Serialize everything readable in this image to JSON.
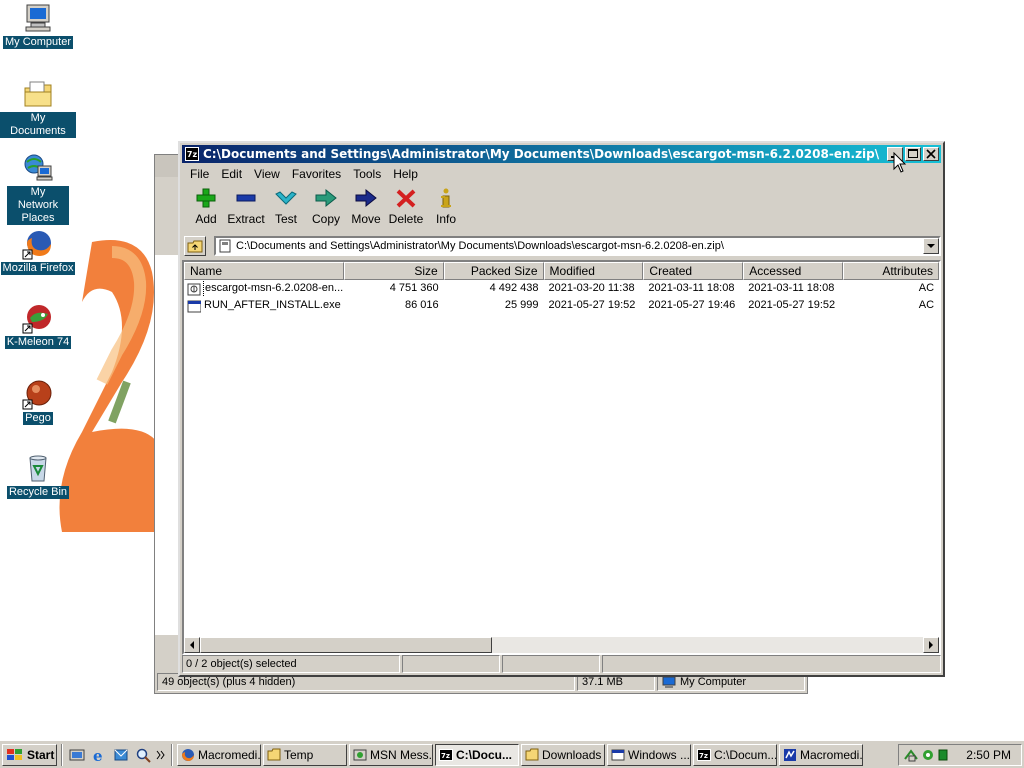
{
  "desktop": {
    "icons": [
      {
        "label": "My Computer"
      },
      {
        "label": "My Documents"
      },
      {
        "label": "My Network Places"
      },
      {
        "label": "Mozilla Firefox"
      },
      {
        "label": "K-Meleon 74"
      },
      {
        "label": "Pego"
      },
      {
        "label": "Recycle Bin"
      }
    ]
  },
  "background_window": {
    "status": {
      "objects": "49 object(s) (plus 4 hidden)",
      "size": "37.1 MB",
      "location": "My Computer"
    }
  },
  "window": {
    "title": "C:\\Documents and Settings\\Administrator\\My Documents\\Downloads\\escargot-msn-6.2.0208-en.zip\\",
    "app_icon": "7z",
    "menu": [
      "File",
      "Edit",
      "View",
      "Favorites",
      "Tools",
      "Help"
    ],
    "toolbar": [
      {
        "label": "Add",
        "icon": "plus-icon",
        "color": "#1aa81a"
      },
      {
        "label": "Extract",
        "icon": "minus-icon",
        "color": "#1a3aa8"
      },
      {
        "label": "Test",
        "icon": "check-icon",
        "color": "#2bb3c9"
      },
      {
        "label": "Copy",
        "icon": "copy-arrow-icon",
        "color": "#2a9a7a"
      },
      {
        "label": "Move",
        "icon": "move-arrow-icon",
        "color": "#1a2a8a"
      },
      {
        "label": "Delete",
        "icon": "delete-x-icon",
        "color": "#d42020"
      },
      {
        "label": "Info",
        "icon": "info-icon",
        "color": "#c9a41a"
      }
    ],
    "address": "C:\\Documents and Settings\\Administrator\\My Documents\\Downloads\\escargot-msn-6.2.0208-en.zip\\",
    "columns": [
      "Name",
      "Size",
      "Packed Size",
      "Modified",
      "Created",
      "Accessed",
      "Attributes"
    ],
    "files": [
      {
        "name": "escargot-msn-6.2.0208-en....",
        "size": "4 751 360",
        "packed": "4 492 438",
        "modified": "2021-03-20 11:38",
        "created": "2021-03-11 18:08",
        "accessed": "2021-03-11 18:08",
        "attributes": "AC"
      },
      {
        "name": "RUN_AFTER_INSTALL.exe",
        "size": "86 016",
        "packed": "25 999",
        "modified": "2021-05-27 19:52",
        "created": "2021-05-27 19:46",
        "accessed": "2021-05-27 19:52",
        "attributes": "AC"
      }
    ],
    "status": "0 / 2 object(s) selected"
  },
  "taskbar": {
    "start": "Start",
    "tasks": [
      {
        "label": "Macromedi..."
      },
      {
        "label": "Temp"
      },
      {
        "label": "MSN Mess..."
      },
      {
        "label": "C:\\Docu..."
      },
      {
        "label": "Downloads"
      },
      {
        "label": "Windows ..."
      },
      {
        "label": "C:\\Docum..."
      },
      {
        "label": "Macromedi..."
      }
    ],
    "clock": "2:50 PM"
  }
}
